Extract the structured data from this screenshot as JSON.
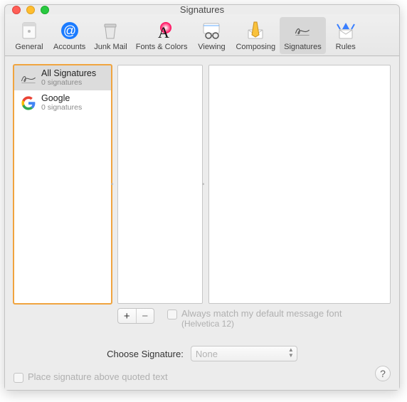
{
  "window": {
    "title": "Signatures"
  },
  "toolbar": {
    "items": [
      {
        "label": "General"
      },
      {
        "label": "Accounts"
      },
      {
        "label": "Junk Mail"
      },
      {
        "label": "Fonts & Colors"
      },
      {
        "label": "Viewing"
      },
      {
        "label": "Composing"
      },
      {
        "label": "Signatures"
      },
      {
        "label": "Rules"
      }
    ]
  },
  "accounts": [
    {
      "name": "All Signatures",
      "sub": "0 signatures"
    },
    {
      "name": "Google",
      "sub": "0 signatures"
    }
  ],
  "addremove": {
    "add": "+",
    "remove": "−"
  },
  "matchFont": {
    "label": "Always match my default message font",
    "sub": "(Helvetica 12)"
  },
  "choose": {
    "label": "Choose Signature:",
    "selected": "None"
  },
  "placeAbove": {
    "label": "Place signature above quoted text"
  },
  "help": "?"
}
